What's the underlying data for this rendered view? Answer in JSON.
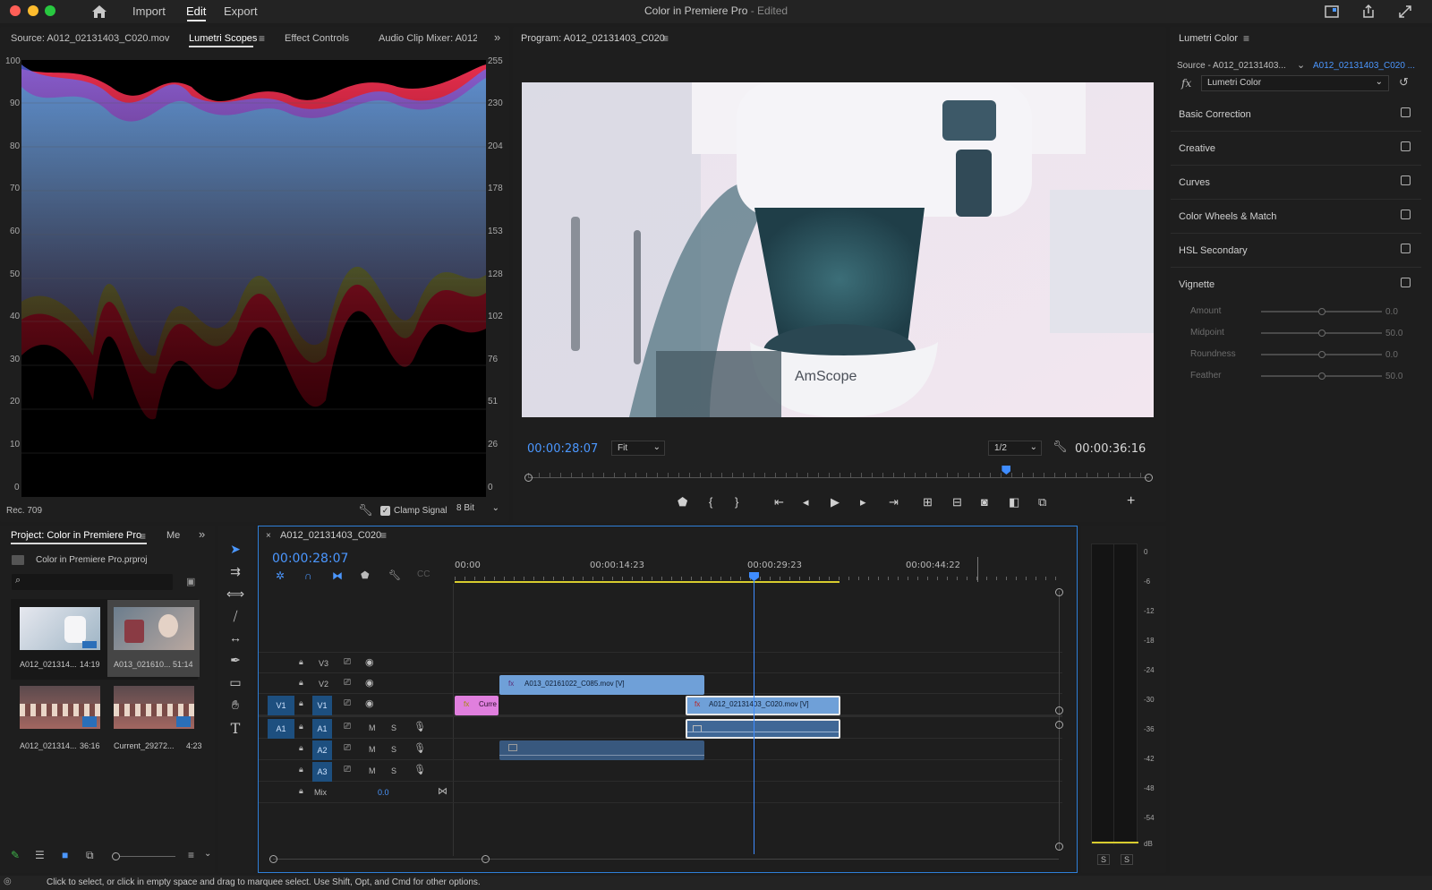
{
  "window": {
    "title": "Color in Premiere Pro",
    "edited": " - Edited",
    "menus": [
      {
        "label": "Import"
      },
      {
        "label": "Edit"
      },
      {
        "label": "Export"
      }
    ]
  },
  "scopes": {
    "tabs": [
      {
        "label": "Source: A012_02131403_C020.mov"
      },
      {
        "label": "Lumetri Scopes"
      },
      {
        "label": "Effect Controls"
      },
      {
        "label": "Audio Clip Mixer: A012_"
      }
    ],
    "left_ticks": [
      "100",
      "90",
      "80",
      "70",
      "60",
      "50",
      "40",
      "30",
      "20",
      "10",
      "0"
    ],
    "right_ticks": [
      "255",
      "230",
      "204",
      "178",
      "153",
      "128",
      "102",
      "76",
      "51",
      "26",
      "0"
    ],
    "standard": "Rec. 709",
    "clamp_label": "Clamp Signal",
    "clamp_checked": true,
    "bit_depth": "8 Bit"
  },
  "program": {
    "title": "Program: A012_02131403_C020",
    "timecode": "00:00:28:07",
    "zoom": "Fit",
    "resolution": "1/2",
    "duration": "00:00:36:16",
    "playhead_fraction": 0.77,
    "overlay_text": "AmScope"
  },
  "lumetri": {
    "title": "Lumetri Color",
    "source_label": "Source - A012_02131403...",
    "source_clip": "A012_02131403_C020 ...",
    "fx_label": "fx",
    "effect": "Lumetri Color",
    "sections": [
      {
        "label": "Basic Correction"
      },
      {
        "label": "Creative"
      },
      {
        "label": "Curves"
      },
      {
        "label": "Color Wheels & Match"
      },
      {
        "label": "HSL Secondary"
      },
      {
        "label": "Vignette"
      }
    ],
    "vignette": [
      {
        "label": "Amount",
        "value": "0.0",
        "pos": 0.5
      },
      {
        "label": "Midpoint",
        "value": "50.0",
        "pos": 0.5
      },
      {
        "label": "Roundness",
        "value": "0.0",
        "pos": 0.5
      },
      {
        "label": "Feather",
        "value": "50.0",
        "pos": 0.5
      }
    ]
  },
  "project": {
    "tab": "Project: Color in Premiere Pro",
    "tab2": "Me",
    "file": "Color in Premiere Pro.prproj",
    "items": [
      {
        "name": "A012_021314...",
        "dur": "14:19"
      },
      {
        "name": "A013_021610...",
        "dur": "51:14"
      },
      {
        "name": "A012_021314...",
        "dur": "36:16"
      },
      {
        "name": "Current_29272...",
        "dur": "4:23"
      }
    ]
  },
  "timeline": {
    "tab": "A012_02131403_C020",
    "timecode": "00:00:28:07",
    "ruler": [
      "00:00",
      "00:00:14:23",
      "00:00:29:23",
      "00:00:44:22"
    ],
    "tracks": [
      {
        "name": "V3"
      },
      {
        "name": "V2"
      },
      {
        "name": "V1",
        "src": "V1"
      },
      {
        "name": "A1",
        "src": "A1"
      },
      {
        "name": "A2"
      },
      {
        "name": "A3"
      }
    ],
    "mix_label": "Mix",
    "mix_value": "0.0",
    "m": "M",
    "s": "S",
    "clips": {
      "v2": "A013_02161022_C085.mov [V]",
      "v1a": "Curre",
      "v1b": "A012_02131403_C020.mov [V]"
    }
  },
  "meter": {
    "db": [
      "0",
      "-6",
      "-12",
      "-18",
      "-24",
      "-30",
      "-36",
      "-42",
      "-48",
      "-54",
      "dB"
    ],
    "solo": [
      "S",
      "S"
    ]
  },
  "status": "Click to select, or click in empty space and drag to marquee select. Use Shift, Opt, and Cmd for other options.",
  "colors": {
    "accent": "#4b97ff",
    "panel": "#1e1e1e",
    "clip_v": "#6fa0d8",
    "clip_pink": "#e07fde",
    "yellow": "#d8cc2e"
  }
}
